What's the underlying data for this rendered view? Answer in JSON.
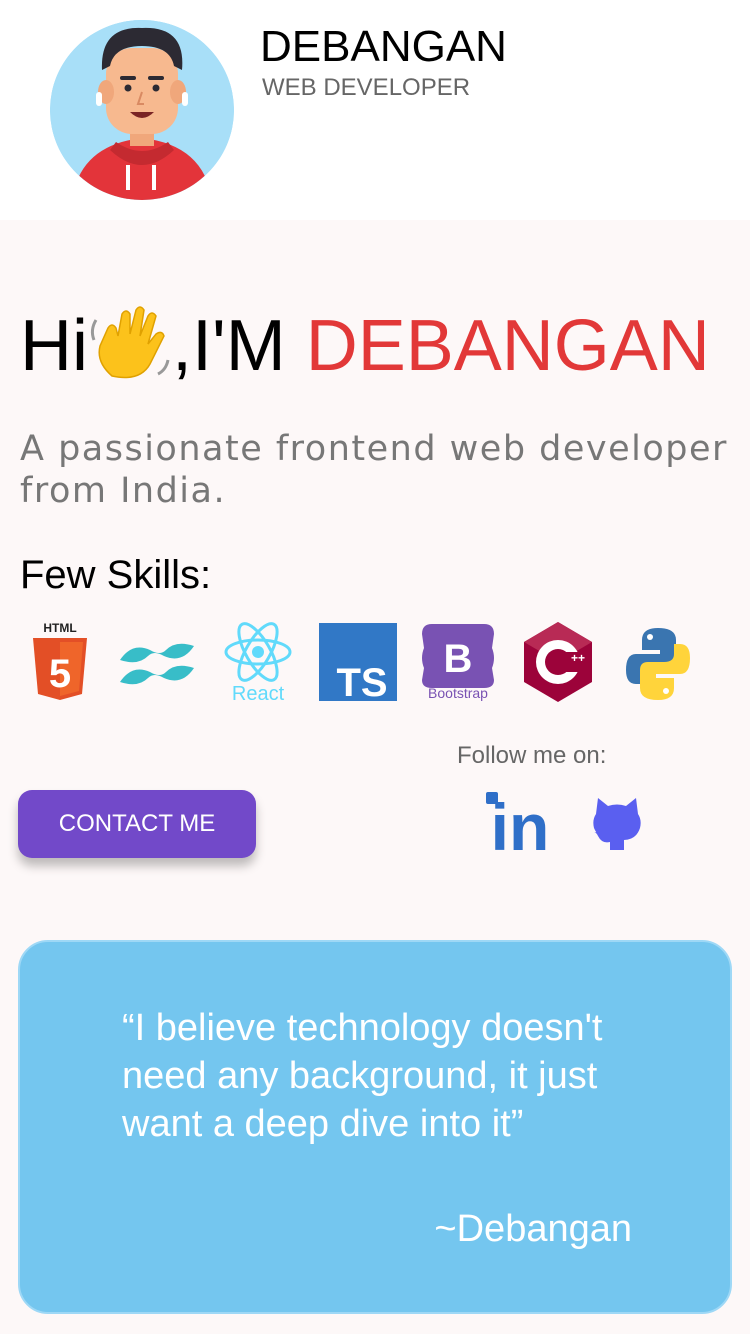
{
  "header": {
    "name": "DEBANGAN",
    "role": "WEB DEVELOPER"
  },
  "hero": {
    "greeting": "Hi",
    "wave_icon": "waving-hand-icon",
    "greeting_suffix": ",I'M ",
    "name": "DEBANGAN",
    "subtitle": "A passionate frontend web developer from India."
  },
  "skills": {
    "title": "Few Skills:",
    "items": [
      {
        "icon": "html5-icon",
        "label": "HTML",
        "badge": "5"
      },
      {
        "icon": "tailwind-icon"
      },
      {
        "icon": "react-icon",
        "label": "React"
      },
      {
        "icon": "typescript-icon",
        "label": "TS"
      },
      {
        "icon": "bootstrap-icon",
        "label": "B",
        "caption": "Bootstrap"
      },
      {
        "icon": "cpp-icon",
        "label": "C",
        "suffix": "++"
      },
      {
        "icon": "python-icon"
      }
    ]
  },
  "contact": {
    "button_label": "CONTACT ME"
  },
  "social": {
    "follow_label": "Follow me on:",
    "linkedin_label": "in",
    "icons": [
      "linkedin-icon",
      "github-icon"
    ]
  },
  "quote": {
    "text": "“I believe technology doesn't need any background, it just want a deep dive into it”",
    "author": "~Debangan"
  },
  "colors": {
    "accent_red": "#e23838",
    "button_purple": "#7249c9",
    "quote_bg": "#74c6ef",
    "page_bg": "#fdf8f8"
  }
}
